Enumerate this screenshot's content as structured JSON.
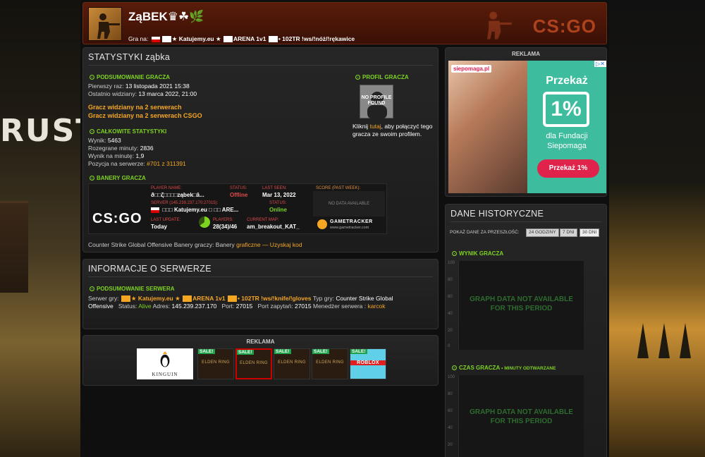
{
  "background": {
    "logo_text": "RUST"
  },
  "header": {
    "player_name": "ZąBEK♛☘🌿",
    "playing_on_label": "Gra na:",
    "server_part1": "★ Katujemy.eu ★",
    "server_part2": "ARENA 1v1",
    "server_part3": "• 102TR !ws/!nóż/!rękawice",
    "logo": "CS:GO"
  },
  "stats": {
    "title": "STATYSTYKI ząbka",
    "summary_heading": "PODSUMOWANIE GRACZA",
    "first_seen_label": "Pierwszy raz:",
    "first_seen": "13 listopada 2021 15:38",
    "last_seen_label": "Ostatnio widziany:",
    "last_seen": "13 marca 2022, 21:00",
    "seen_line1": "Gracz widziany na 2 serwerach",
    "seen_line2": "Gracz widziany na 2 serwerach CSGO",
    "total_heading": "CAŁKOWITE STATYSTYKI",
    "score_label": "Wynik:",
    "score": "5463",
    "minutes_label": "Rozegrane minuty:",
    "minutes": "2836",
    "spm_label": "Wynik na minutę:",
    "spm": "1,9",
    "rank_label": "Pozycja na serwerze:",
    "rank": "#701 z 311391",
    "banners_heading": "BANERY GRACZA",
    "profile_heading": "PROFIL GRACZA",
    "no_profile": "NO PROFILE FOUND",
    "profile_text_pre": "Kliknij",
    "profile_link": "tutaj",
    "profile_text_post": ", aby połączyć tego gracza ze swoim profilem.",
    "banner_footer_pre": "Counter Strike Global Offensive Banery graczy: Banery",
    "banner_footer_link": "graficzne — Uzyskaj kod"
  },
  "banner": {
    "logo": "CS:GO",
    "player_name_label": "PLAYER NAME:",
    "player_name": "ð□□ζ□□□□ząbek□â...",
    "status_label": "STATUS:",
    "status": "Offline",
    "last_seen_label": "LAST SEEN:",
    "last_seen": "Mar 13, 2022",
    "score_label": "SCORE (past week):",
    "no_data": "NO DATA AVAILABLE",
    "server_label": "SERVER (145.239.237.170:27015):",
    "server": "□□□ Katujemy.eu □ □□ ARE...",
    "server_status_label": "STATUS:",
    "server_status": "Online",
    "last_update_label": "LAST UPDATE:",
    "last_update": "Today",
    "players_label": "PLAYERS:",
    "players": "28(34)/46",
    "map_label": "CURRENT MAP:",
    "map": "am_breakout_KAT_",
    "tracker": "GAMETRACKER",
    "tracker_url": "www.gametracker.com",
    "players_fraction": 0.65
  },
  "server_info": {
    "title": "INFORMACJE O SERWERZE",
    "summary_heading": "PODSUMOWANIE SERWERA",
    "server_label": "Serwer gry:",
    "server_name1": "★ Katujemy.eu ★",
    "server_name2": "ARENA 1v1",
    "server_name3": "• 102TR !ws/!knife/!gloves",
    "game_type_label": "Typ gry:",
    "game_type1": "Counter Strike Global",
    "game_type2": "Offensive",
    "status_label": "Status:",
    "status": "Alive",
    "address_label": "Adres:",
    "address": "145.239.237.170",
    "port_label": "Port:",
    "port": "27015",
    "query_label": "Port zapytań:",
    "query_port": "27015",
    "manager_label": "Menedżer serwera :",
    "manager": "karcok"
  },
  "ads_bottom": {
    "title": "REKLAMA",
    "kinguin": "KINGUIN",
    "items": [
      {
        "sale": "SALE!",
        "label": "ELDEN RING"
      },
      {
        "sale": "SALE!",
        "label": "ELDEN RING"
      },
      {
        "sale": "SALE!",
        "label": "ELDEN RING"
      },
      {
        "sale": "SALE!",
        "label": "ELDEN RING"
      },
      {
        "sale": "SALE!",
        "label": "ROBLOX"
      }
    ]
  },
  "ad_right": {
    "title": "REKLAMA",
    "brand": "siepomaga.pl",
    "headline": "Przekaż",
    "percent": "1%",
    "line1": "dla Fundacji",
    "line2": "Siepomaga",
    "cta": "Przekaż 1%"
  },
  "history": {
    "title": "DANE HISTORYCZNE",
    "period_label": "POKAŻ DANE ZA PRZESZŁOŚĆ:",
    "periods": [
      "24 GODZINY",
      "7 DNI",
      "30 DNI"
    ],
    "score_heading": "WYNIK GRACZA",
    "time_heading": "CZAS GRACZA",
    "time_sub": "• MINUTY ODTWARZANE",
    "na_line1": "GRAPH DATA NOT AVAILABLE",
    "na_line2": "FOR THIS PERIOD",
    "ticks": [
      "100",
      "80",
      "60",
      "40",
      "20",
      "0"
    ]
  }
}
